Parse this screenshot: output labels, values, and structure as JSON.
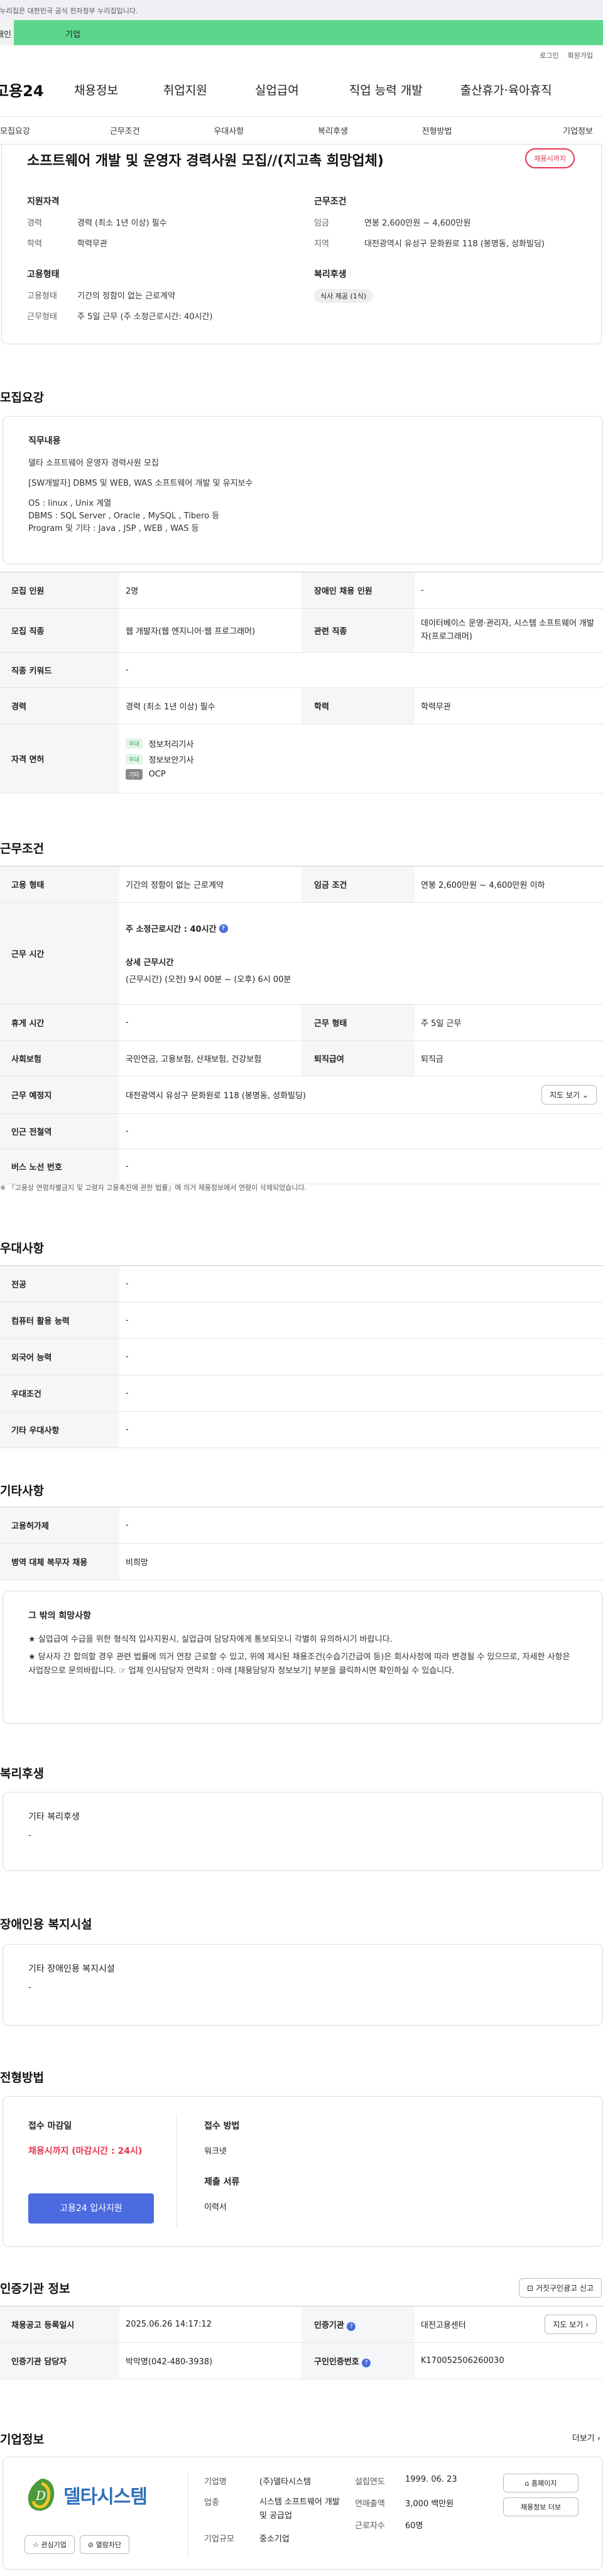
{
  "banner": {
    "text": "이 누리집은 대한민국 공식 전자정부 누리집입니다."
  },
  "user_tabs": {
    "individual": "개인",
    "company": "기업"
  },
  "top_links": [
    "로그인",
    "회원가입"
  ],
  "gnb": {
    "logo": "고용24",
    "items": [
      "채용정보",
      "취업지원",
      "실업급여",
      "직업 능력 개발",
      "출산휴가·육아휴직"
    ]
  },
  "tabs": [
    "모집요강",
    "근무조건",
    "우대사항",
    "복리후생",
    "전형방법",
    "기업정보"
  ],
  "job": {
    "title": "소프트웨어 개발 및 운영자 경력사원 모집//(지고촉 희망업체)",
    "badge": "채용시까지",
    "qualification_title": "지원자격",
    "experience_label": "경력",
    "experience_value": "경력 (최소 1년 이상) 필수",
    "education_label": "학력",
    "education_value": "학력무관",
    "work_conditions_title": "근무조건",
    "wage_label": "임금",
    "wage_value": "연봉 2,600만원 ~ 4,600만원",
    "region_label": "지역",
    "region_value": "대전광역시 유성구 문화원로 118 (봉명동, 성화빌딩)",
    "employment_title": "고용형태",
    "employ_type_label": "고용형태",
    "employ_type_value": "기간의 정함이 없는 근로계약",
    "work_type_label": "근무형태",
    "work_type_value": "주 5일 근무 (주 소정근로시간: 40시간)",
    "welfare_title": "복리후생",
    "welfare_chip": "식사 제공 (1식)"
  },
  "recruit": {
    "section_title": "모집요강",
    "duty_title": "직무내용",
    "duty_lines": [
      "델타 소프트웨어 운영자 경력사원 모집",
      "[SW개발자]  DBMS 및 WEB, WAS 소프트웨어 개발 및 유지보수",
      "OS : linux , Unix 계열",
      "DBMS : SQL Server , Oracle , MySQL , Tibero 등",
      "Program 및 기타 : Java , JSP , WEB , WAS 등"
    ],
    "table": {
      "headcount_label": "모집 인원",
      "headcount_value": "2명",
      "disabled_label": "장애인 채용 인원",
      "disabled_value": "-",
      "job_label": "모집 직종",
      "job_value": "웹 개발자(웹 엔지니어·웹 프로그래머)",
      "related_label": "관련 직종",
      "related_value": "데이터베이스 운영·관리자, 시스템 소프트웨어 개발자(프로그래머)",
      "keyword_label": "직종 키워드",
      "keyword_value": "-",
      "career_label": "경력",
      "career_value": "경력 (최소 1년 이상) 필수",
      "edu_label": "학력",
      "edu_value": "학력무관",
      "license_label": "자격 면허",
      "licenses": [
        {
          "tag": "우대",
          "name": "정보처리기사"
        },
        {
          "tag": "우대",
          "name": "정보보안기사"
        },
        {
          "tag": "기타",
          "name": "OCP"
        }
      ]
    }
  },
  "work": {
    "section_title": "근무조건",
    "employ_label": "고용 형태",
    "employ_value": "기간의 정함이 없는 근로계약",
    "wage_label": "임금 조건",
    "wage_value": "연봉 2,600만원 ~ 4,600만원 이하",
    "hours_label": "근무 시간",
    "hours_total": "주 소정근로시간 : 40시간",
    "hours_detail_title": "상세 근무시간",
    "hours_detail": "(근무시간) (오전) 9시 00분 ~ (오후) 6시 00분",
    "break_label": "휴게 시간",
    "break_value": "-",
    "worktype_label": "근무 형태",
    "worktype_value": "주 5일 근무",
    "insurance_label": "사회보험",
    "insurance_value": "국민연금, 고용보험, 산재보험, 건강보험",
    "retire_label": "퇴직급여",
    "retire_value": "퇴직금",
    "place_label": "근무 예정지",
    "place_value": "대전광역시 유성구 문화원로 118 (봉명동, 성화빌딩)",
    "map_button": "지도 보기",
    "subway_label": "인근 전철역",
    "subway_value": "-",
    "bus_label": "버스 노선 번호",
    "bus_value": "-",
    "footnote": "『고용상 연령차별금지 및 고령자 고용촉진에 관한 법률』에 의거 채용정보에서 연령이 삭제되었습니다."
  },
  "pref": {
    "section_title": "우대사항",
    "rows": [
      {
        "label": "전공",
        "value": "-"
      },
      {
        "label": "컴퓨터 활용 능력",
        "value": "-"
      },
      {
        "label": "외국어 능력",
        "value": "-"
      },
      {
        "label": "우대조건",
        "value": "-"
      },
      {
        "label": "기타 우대사항",
        "value": "-"
      }
    ]
  },
  "etc": {
    "section_title": "기타사항",
    "insurance_label": "고용허가제",
    "insurance_value": "-",
    "military_label": "병역 대체 복무자 채용",
    "military_value": "비희망",
    "other_title": "그 밖의 희망사항",
    "other_lines": [
      "★ 실업급여 수급을 위한 형식적 입사지원시, 실업급여 담당자에게 통보되오니 각별히 유의하시기 바랍니다.",
      "★ 당사자 간 합의할 경우 관련 법률에 의거 연장 근로할 수 있고, 위에 제시된 채용조건(수습기간급여 등)은 회사사정에 따라 변경될 수 있으므로, 자세한 사항은 사업장으로 문의바랍니다. ☞ 업체 인사담당자 연락처 : 아래 [채용담당자 정보보기] 부분을 클릭하시면 확인하실 수 있습니다."
    ]
  },
  "welfare": {
    "section_title": "복리후생",
    "box_title": "기타 복리후생",
    "box_value": "-"
  },
  "disabled": {
    "section_title": "장애인용 복지시설",
    "box_title": "기타 장애인용 복지시설",
    "box_value": "-"
  },
  "screening": {
    "section_title": "전형방법",
    "deadline_title": "접수 마감일",
    "deadline_value": "채용시까지 (마감시간 : 24시)",
    "apply_button": "고용24 입사지원",
    "method_title": "접수 방법",
    "method_value": "워크넷",
    "docs_title": "제출 서류",
    "docs_value": "이력서"
  },
  "cert": {
    "section_title": "인증기관 정보",
    "report_button": "거짓구인광고 신고",
    "reg_label": "채용공고 등록일시",
    "reg_value": "2025.06.26 14:17:12",
    "agency_label": "인증기관",
    "agency_value": "대전고용센터",
    "map_button": "지도 보기",
    "manager_label": "인증기관 담당자",
    "manager_value": "박막명(042-480-3938)",
    "id_label": "구인인증번호",
    "id_value": "K170052506260030"
  },
  "company": {
    "section_title": "기업정보",
    "more": "더보기",
    "logo_text": "델타시스템",
    "name_label": "기업명",
    "name_value": "(주)델타시스템",
    "industry_label": "업종",
    "industry_value": "시스템 소프트웨어 개발 및 공급업",
    "size_label": "기업규모",
    "size_value": "중소기업",
    "founded_label": "설립연도",
    "founded_value": "1999. 06. 23",
    "sales_label": "연매출액",
    "sales_value": "3,000 백만원",
    "staff_label": "근로자수",
    "staff_value": "60명",
    "homepage_button": "홈페이지",
    "jobs_button": "채용정보 더보",
    "fav_button": "관심기업",
    "block_button": "열람차단"
  }
}
